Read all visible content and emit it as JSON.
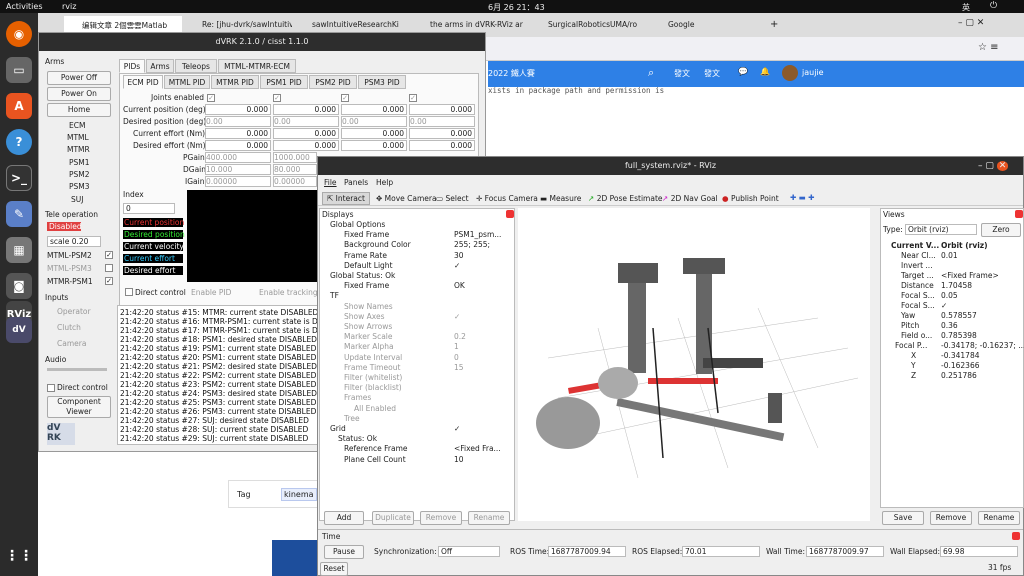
{
  "topbar": {
    "activities": "Activities",
    "app": "rviz",
    "clock": "6月 26 21：43",
    "lang": "英"
  },
  "browser": {
    "tabs": [
      "编辑文章 2個雲雲Matlab",
      "Re: [jhu-dvrk/sawIntuitiv",
      "sawIntuitiveResearchKi",
      "the arms in dVRK-RViz ar",
      "SurgicalRoboticsUMA/ro",
      "Google"
    ],
    "nav": {
      "title": "2022 鐵人賽",
      "post": "發文",
      "publish": "發文",
      "user": "jaujie"
    },
    "page_text": "xists in package path and permission is",
    "tag_label": "Tag",
    "tag_chip": "kinema"
  },
  "dvrk": {
    "title": "dVRK 2.1.0 / cisst 1.1.0",
    "arms_label": "Arms",
    "power_off": "Power Off",
    "power_on": "Power On",
    "home": "Home",
    "arm_list": [
      "ECM",
      "MTML",
      "MTMR",
      "PSM1",
      "PSM2",
      "PSM3",
      "SUJ"
    ],
    "teleop_label": "Tele operation",
    "disabled": "Disabled",
    "scale": "scale 0.20",
    "teleop_pairs": [
      "MTML-PSM2",
      "MTML-PSM3",
      "MTMR-PSM1"
    ],
    "inputs_label": "Inputs",
    "inputs": [
      "Operator",
      "Clutch",
      "Camera"
    ],
    "audio_label": "Audio",
    "direct_control": "Direct control",
    "component_viewer": "Component Viewer",
    "top_tabs": [
      "PIDs",
      "Arms",
      "Teleops",
      "MTML-MTMR-ECM"
    ],
    "pid_tabs": [
      "ECM PID",
      "MTML PID",
      "MTMR PID",
      "PSM1 PID",
      "PSM2 PID",
      "PSM3 PID"
    ],
    "rows": [
      "Joints enabled",
      "Current position (deg)",
      "Desired position (deg)",
      "Current effort (Nm)",
      "Desired effort (Nm)",
      "PGain",
      "DGain",
      "IGain"
    ],
    "values": {
      "cur_pos": [
        "0.000",
        "0.000",
        "0.000",
        "0.000"
      ],
      "des_pos": [
        "0.00",
        "0.00",
        "0.00",
        "0.00"
      ],
      "cur_eff": [
        "0.000",
        "0.000",
        "0.000",
        "0.000"
      ],
      "des_eff": [
        "0.000",
        "0.000",
        "0.000",
        "0.000"
      ],
      "pgain": [
        "400.000",
        "1000.000"
      ],
      "dgain": [
        "10.000",
        "80.000"
      ],
      "igain": [
        "0.00000",
        "0.00000"
      ]
    },
    "index_label": "Index",
    "index_value": "0",
    "legend": [
      "Current position",
      "Desired position",
      "Current velocity",
      "Current effort",
      "Desired effort"
    ],
    "bottom_checks": [
      "Direct control",
      "Enable PID",
      "Enable tracking"
    ],
    "log": [
      "21:42:20 status #15: MTMR: current state DISABLED",
      "21:42:20 status #16: MTMR-PSM1: current state is DISA",
      "21:42:20 status #17: MTMR-PSM1: current state is DISA",
      "21:42:20 status #18: PSM1: desired state DISABLED",
      "21:42:20 status #19: PSM1: current state DISABLED",
      "21:42:20 status #20: PSM1: current state DISABLED",
      "21:42:20 status #21: PSM2: desired state DISABLED",
      "21:42:20 status #22: PSM2: current state DISABLED",
      "21:42:20 status #23: PSM2: current state DISABLED",
      "21:42:20 status #24: PSM3: desired state DISABLED",
      "21:42:20 status #25: PSM3: current state DISABLED",
      "21:42:20 status #26: PSM3: current state DISABLED",
      "21:42:20 status #27: SUJ: desired state DISABLED",
      "21:42:20 status #28: SUJ: current state DISABLED",
      "21:42:20 status #29: SUJ: current state DISABLED"
    ]
  },
  "rviz": {
    "title": "full_system.rviz* - RViz",
    "menu": [
      "File",
      "Panels",
      "Help"
    ],
    "tools": [
      "Interact",
      "Move Camera",
      "Select",
      "Focus Camera",
      "Measure",
      "2D Pose Estimate",
      "2D Nav Goal",
      "Publish Point"
    ],
    "displays_title": "Displays",
    "tree": [
      [
        "Global Options",
        ""
      ],
      [
        "Fixed Frame",
        "PSM1_psm..."
      ],
      [
        "Background Color",
        "255; 255;"
      ],
      [
        "Frame Rate",
        "30"
      ],
      [
        "Default Light",
        "✓"
      ],
      [
        "Global Status: Ok",
        ""
      ],
      [
        "Fixed Frame",
        "OK"
      ],
      [
        "TF",
        ""
      ],
      [
        "Show Names",
        ""
      ],
      [
        "Show Axes",
        "✓"
      ],
      [
        "Show Arrows",
        ""
      ],
      [
        "Marker Scale",
        "0.2"
      ],
      [
        "Marker Alpha",
        "1"
      ],
      [
        "Update Interval",
        "0"
      ],
      [
        "Frame Timeout",
        "15"
      ],
      [
        "Filter (whitelist)",
        ""
      ],
      [
        "Filter (blacklist)",
        ""
      ],
      [
        "Frames",
        ""
      ],
      [
        "All Enabled",
        ""
      ],
      [
        "Tree",
        ""
      ],
      [
        "Grid",
        "✓"
      ],
      [
        "Status: Ok",
        ""
      ],
      [
        "Reference Frame",
        "<Fixed Fra..."
      ],
      [
        "Plane Cell Count",
        "10"
      ]
    ],
    "display_buttons": [
      "Add",
      "Duplicate",
      "Remove",
      "Rename"
    ],
    "views_title": "Views",
    "views_type_label": "Type:",
    "views_type": "Orbit (rviz)",
    "zero": "Zero",
    "views_tree": [
      [
        "Current V...",
        "Orbit (rviz)"
      ],
      [
        "Near Cl...",
        "0.01"
      ],
      [
        "Invert ...",
        ""
      ],
      [
        "Target ...",
        "<Fixed Frame>"
      ],
      [
        "Distance",
        "1.70458"
      ],
      [
        "Focal S...",
        "0.05"
      ],
      [
        "Focal S...",
        "✓"
      ],
      [
        "Yaw",
        "0.578557"
      ],
      [
        "Pitch",
        "0.36"
      ],
      [
        "Field o...",
        "0.785398"
      ],
      [
        "Focal P...",
        "-0.34178; -0.16237; ..."
      ],
      [
        "X",
        "-0.341784"
      ],
      [
        "Y",
        "-0.162366"
      ],
      [
        "Z",
        "0.251786"
      ]
    ],
    "views_buttons": [
      "Save",
      "Remove",
      "Rename"
    ],
    "time_title": "Time",
    "pause": "Pause",
    "sync_label": "Synchronization:",
    "sync_value": "Off",
    "ros_time_label": "ROS Time:",
    "ros_time": "1687787009.94",
    "ros_elapsed_label": "ROS Elapsed:",
    "ros_elapsed": "70.01",
    "wall_time_label": "Wall Time:",
    "wall_time": "1687787009.97",
    "wall_elapsed_label": "Wall Elapsed:",
    "wall_elapsed": "69.98",
    "reset": "Reset",
    "fps": "31 fps"
  }
}
